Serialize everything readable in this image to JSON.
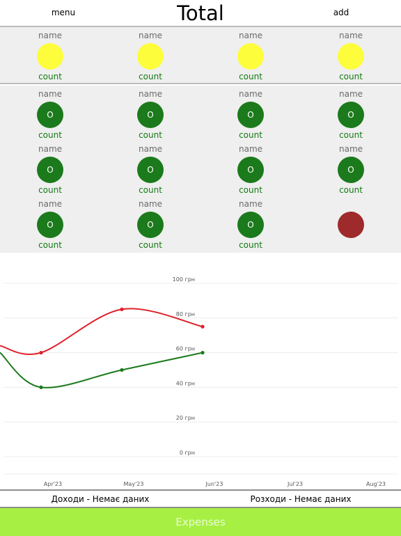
{
  "header": {
    "menu_label": "menu",
    "title": "Total",
    "add_label": "add"
  },
  "accounts": [
    {
      "name": "name",
      "count": "count",
      "color": "#fdfd3c"
    },
    {
      "name": "name",
      "count": "count",
      "color": "#fdfd3c"
    },
    {
      "name": "name",
      "count": "count",
      "color": "#fdfd3c"
    },
    {
      "name": "name",
      "count": "count",
      "color": "#fdfd3c"
    }
  ],
  "categories": [
    {
      "name": "name",
      "count": "count",
      "icon_text": "O"
    },
    {
      "name": "name",
      "count": "count",
      "icon_text": "O"
    },
    {
      "name": "name",
      "count": "count",
      "icon_text": "O"
    },
    {
      "name": "name",
      "count": "count",
      "icon_text": "O"
    },
    {
      "name": "name",
      "count": "count",
      "icon_text": "O"
    },
    {
      "name": "name",
      "count": "count",
      "icon_text": "O"
    },
    {
      "name": "name",
      "count": "count",
      "icon_text": "O"
    },
    {
      "name": "name",
      "count": "count",
      "icon_text": "O"
    },
    {
      "name": "name",
      "count": "count",
      "icon_text": "O"
    },
    {
      "name": "name",
      "count": "count",
      "icon_text": "O"
    },
    {
      "name": "name",
      "count": "count",
      "icon_text": "O"
    }
  ],
  "add_category_color": "#9e2a2b",
  "chart_data": {
    "type": "line",
    "x": [
      "Apr'23",
      "May'23",
      "Jun'23",
      "Jul'23",
      "Aug'23"
    ],
    "y_ticks": [
      "100 грн",
      "80 грн",
      "60 грн",
      "40 грн",
      "20 грн",
      "0 грн"
    ],
    "ylim": [
      0,
      100
    ],
    "series": [
      {
        "color": "#e0202a",
        "values": [
          60,
          85,
          75,
          null,
          null
        ]
      },
      {
        "color": "#1b7a1b",
        "values": [
          40,
          50,
          60,
          null,
          null
        ]
      }
    ],
    "grid": true
  },
  "summary": {
    "income": "Доходи - Немає даних",
    "expenses": "Розходи - Немає даних"
  },
  "expenses_button": "Expenses"
}
